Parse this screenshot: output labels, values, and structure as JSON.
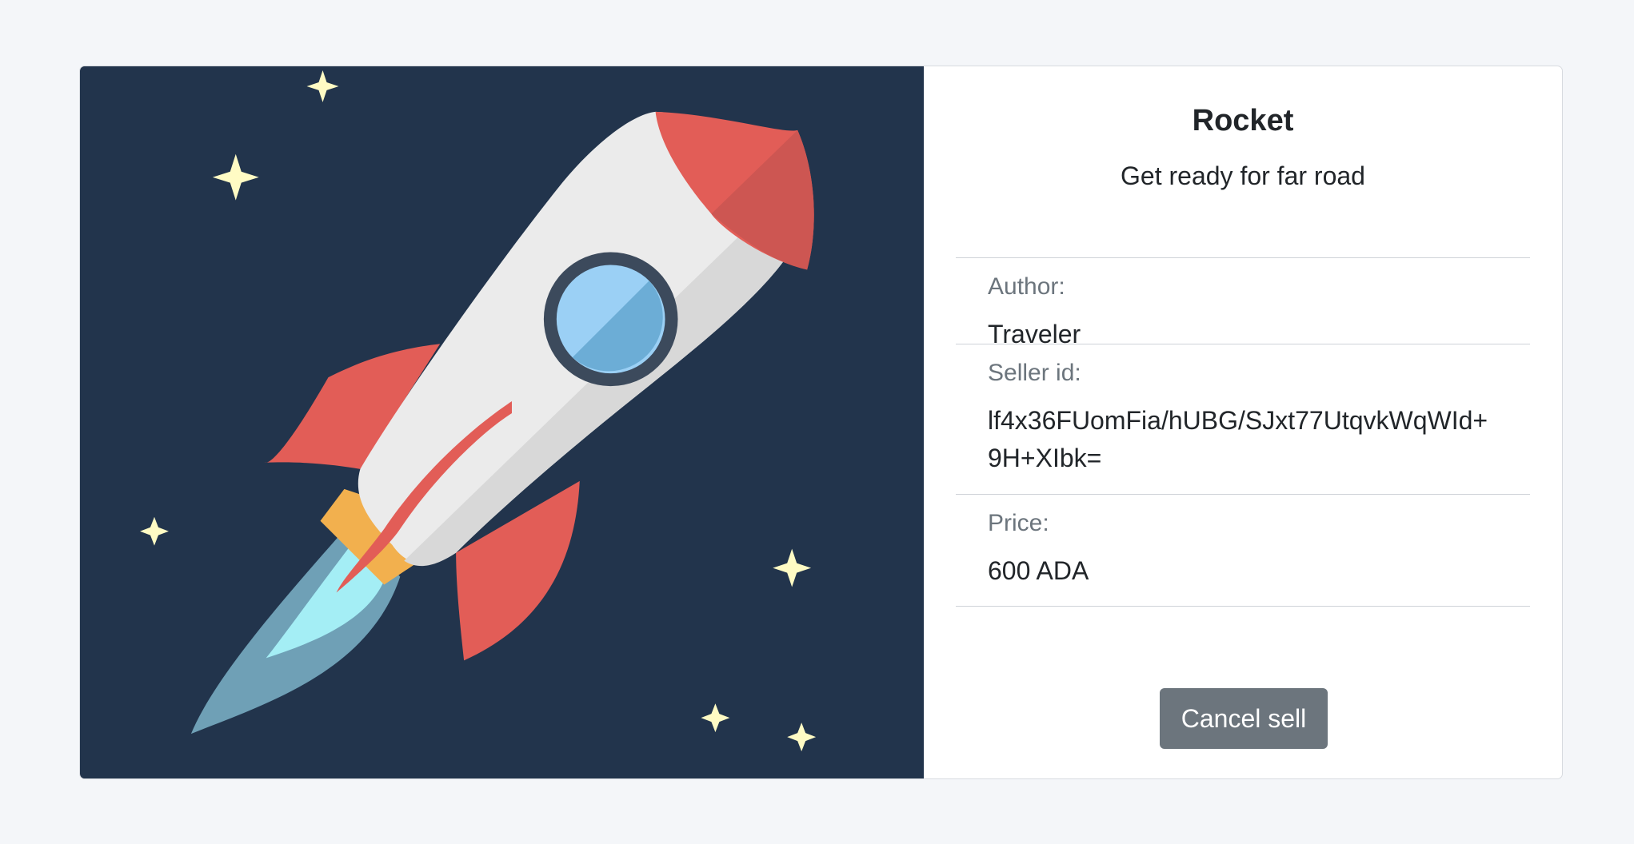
{
  "product": {
    "title": "Rocket",
    "subtitle": "Get ready for far road",
    "image_icon": "rocket-illustration",
    "details": [
      {
        "label": "Author:",
        "value": "Traveler"
      },
      {
        "label": "Seller id:",
        "value": "lf4x36FUomFia/hUBG/SJxt77UtqvkWqWId+9H+XIbk="
      },
      {
        "label": "Price:",
        "value": "600 ADA"
      }
    ],
    "cancel_label": "Cancel sell"
  },
  "colors": {
    "page_background": "#f4f6f9",
    "image_background": "#22344c",
    "button_background": "#6c757d",
    "rocket_red": "#e25d57",
    "rocket_body": "#ebebeb",
    "window_blue": "#7cb9e8",
    "flame_blue": "#6fa0b6",
    "star_yellow": "#fffbc4"
  }
}
